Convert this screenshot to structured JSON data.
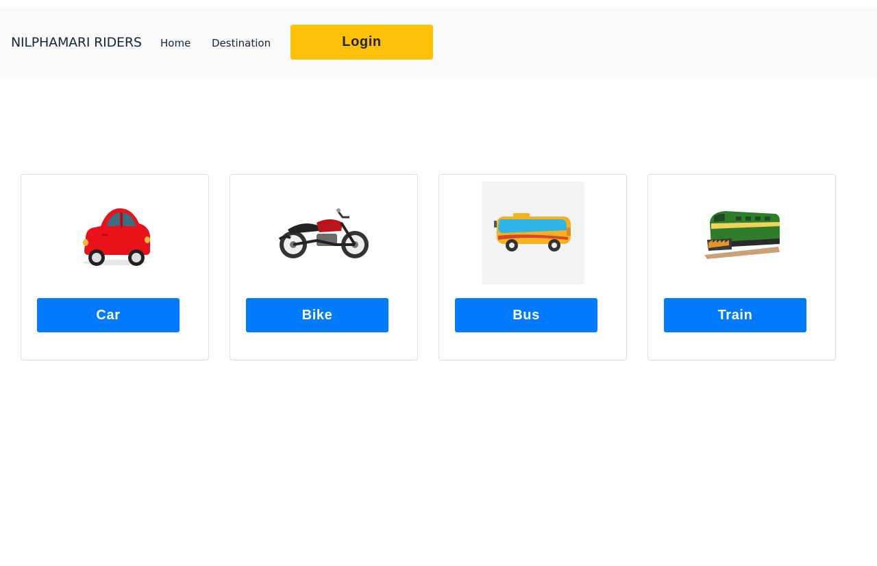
{
  "navbar": {
    "brand": "NILPHAMARI RIDERS",
    "links": [
      "Home",
      "Destination"
    ],
    "login_label": "Login"
  },
  "colors": {
    "login": "#ffc107",
    "card_button": "#007bff",
    "navbar_bg": "#f8f9fa"
  },
  "vehicles": [
    {
      "label": "Car",
      "icon": "car-icon"
    },
    {
      "label": "Bike",
      "icon": "motorbike-icon"
    },
    {
      "label": "Bus",
      "icon": "bus-icon"
    },
    {
      "label": "Train",
      "icon": "train-icon"
    }
  ]
}
